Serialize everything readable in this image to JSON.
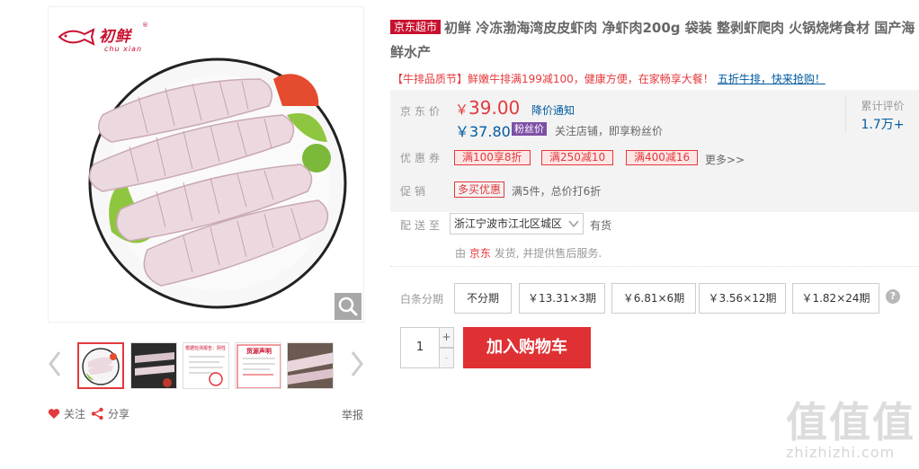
{
  "gallery": {
    "logo_text": "初鲜",
    "logo_reg": "®",
    "logo_sub": "chu xian",
    "thumb_texts": [
      "",
      "",
      "根据检测报告：阴性",
      "货源声明",
      ""
    ],
    "actions": {
      "follow": "关注",
      "share": "分享",
      "report": "举报"
    }
  },
  "title": {
    "tag": "京东超市",
    "text": "初鲜 冷冻渤海湾皮皮虾肉 净虾肉200g 袋装 整剥虾爬肉 火锅烧烤食材 国产海鲜水产"
  },
  "promo": {
    "text": "【牛排品质节】鲜嫩牛排满199减100，健康方便，在家畅享大餐！",
    "link": "五折牛排，快来抢购！"
  },
  "price": {
    "label": "京东价",
    "currency": "￥",
    "value": "39.00",
    "notify": "降价通知",
    "fan_price": "￥37.80",
    "fan_tag": "粉丝价",
    "fan_note": "关注店铺，即享粉丝价",
    "review_label": "累计评价",
    "review_count": "1.7万+"
  },
  "coupons": {
    "label": "优惠券",
    "items": [
      "满100享8折",
      "满250减10",
      "满400减16"
    ],
    "more": "更多>>"
  },
  "promotion": {
    "label": "促销",
    "tag": "多买优惠",
    "text": "满5件，总价打6折"
  },
  "delivery": {
    "label": "配送至",
    "address": "浙江宁波市江北区城区",
    "stock": "有货",
    "seller_prefix": "由",
    "seller_name": "京东",
    "seller_suffix": "发货, 并提供售后服务."
  },
  "baitiao": {
    "label": "白条分期",
    "options": [
      "不分期",
      "￥13.31×3期",
      "￥6.81×6期",
      "￥3.56×12期",
      "￥1.82×24期"
    ],
    "help": "?"
  },
  "purchase": {
    "quantity": "1",
    "plus": "+",
    "minus": "-",
    "cart": "加入购物车"
  },
  "watermark": {
    "glyphs": "值值值",
    "url": "zhizhizhi.com"
  },
  "colors": {
    "accent": "#e4393c",
    "link": "#005aa0",
    "cart": "#df3033",
    "fan": "#7e4fa6"
  }
}
